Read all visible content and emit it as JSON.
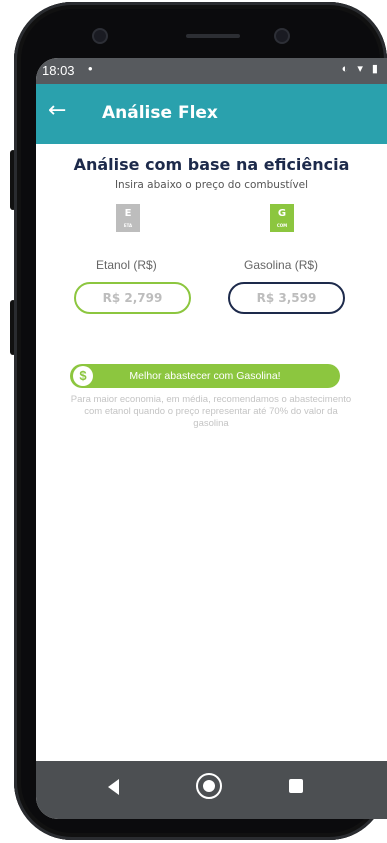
{
  "status_bar": {
    "time": "18:03",
    "dot": "•",
    "icons": "◐ ▾ ▮"
  },
  "app_bar": {
    "back_icon": "arrow-left-icon",
    "title": "Análise Flex"
  },
  "main": {
    "heading": "Análise com base na eficiência",
    "subheading": "Insira abaixo o preço do combustível",
    "etanol": {
      "badge_letter": "E",
      "badge_small": "ETA",
      "label": "Etanol (R$)",
      "value": "R$ 2,799",
      "color": "#8cc63f"
    },
    "gasolina": {
      "badge_letter": "G",
      "badge_small": "COM",
      "label": "Gasolina (R$)",
      "value": "R$ 3,599",
      "color": "#1d2a4b"
    },
    "result": {
      "icon": "dollar-coin-icon",
      "symbol": "$",
      "text": "Melhor abastecer com Gasolina!"
    },
    "note": "Para maior economia, em média, recomendamos o abastecimento com etanol quando o preço representar até 70% do valor da gasolina"
  },
  "navigation": {
    "back": "nav-back-icon",
    "home": "nav-home-icon",
    "recents": "nav-recents-icon"
  },
  "colors": {
    "accent": "#2aa1ad",
    "green": "#8cc63f",
    "navy": "#1d2a4b"
  }
}
